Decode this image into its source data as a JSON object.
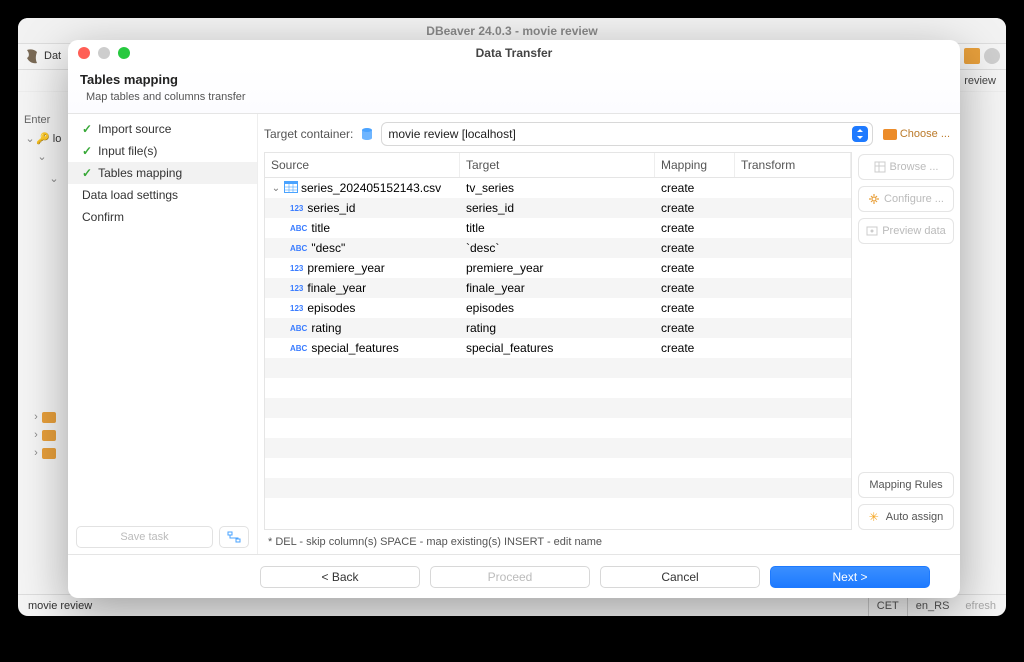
{
  "bg_window": {
    "title": "DBeaver 24.0.3 - movie review",
    "toolbar_left": "Dat",
    "tab_right": "review",
    "sidebar_hint_label": "Enter",
    "status_left": "movie review",
    "status_tz": "CET",
    "status_locale": "en_RS",
    "status_refresh": "efresh"
  },
  "dialog": {
    "title": "Data Transfer",
    "header_title": "Tables mapping",
    "header_subtitle": "Map tables and columns transfer",
    "steps": [
      {
        "label": "Import source",
        "done": true,
        "selected": false
      },
      {
        "label": "Input file(s)",
        "done": true,
        "selected": false
      },
      {
        "label": "Tables mapping",
        "done": true,
        "selected": true
      },
      {
        "label": "Data load settings",
        "done": false,
        "selected": false
      },
      {
        "label": "Confirm",
        "done": false,
        "selected": false
      }
    ],
    "save_task": "Save task",
    "target_container_label": "Target container:",
    "target_container_value": "movie review  [localhost]",
    "choose_label": "Choose ...",
    "columns": {
      "source": "Source",
      "target": "Target",
      "mapping": "Mapping",
      "transform": "Transform"
    },
    "rows": [
      {
        "src_icon": "table",
        "indent": 0,
        "expand": "open",
        "source": "series_202405152143.csv",
        "target": "tv_series",
        "mapping": "create",
        "transform": ""
      },
      {
        "src_icon": "123",
        "indent": 1,
        "source": "series_id",
        "target": "series_id",
        "mapping": "create",
        "transform": ""
      },
      {
        "src_icon": "abc",
        "indent": 1,
        "source": "title",
        "target": "title",
        "mapping": "create",
        "transform": ""
      },
      {
        "src_icon": "abc",
        "indent": 1,
        "source": "\"desc\"",
        "target": "`desc`",
        "mapping": "create",
        "transform": ""
      },
      {
        "src_icon": "123",
        "indent": 1,
        "source": "premiere_year",
        "target": "premiere_year",
        "mapping": "create",
        "transform": ""
      },
      {
        "src_icon": "123",
        "indent": 1,
        "source": "finale_year",
        "target": "finale_year",
        "mapping": "create",
        "transform": ""
      },
      {
        "src_icon": "123",
        "indent": 1,
        "source": "episodes",
        "target": "episodes",
        "mapping": "create",
        "transform": ""
      },
      {
        "src_icon": "abc",
        "indent": 1,
        "source": "rating",
        "target": "rating",
        "mapping": "create",
        "transform": ""
      },
      {
        "src_icon": "abc",
        "indent": 1,
        "source": "special_features",
        "target": "special_features",
        "mapping": "create",
        "transform": ""
      }
    ],
    "side_buttons": {
      "browse": "Browse ...",
      "configure": "Configure ...",
      "preview": "Preview data",
      "mapping_rules": "Mapping Rules",
      "auto_assign": "Auto assign"
    },
    "hint_text": "* DEL - skip column(s)  SPACE - map existing(s)  INSERT - edit name",
    "buttons": {
      "back": "< Back",
      "proceed": "Proceed",
      "cancel": "Cancel",
      "next": "Next >"
    }
  }
}
